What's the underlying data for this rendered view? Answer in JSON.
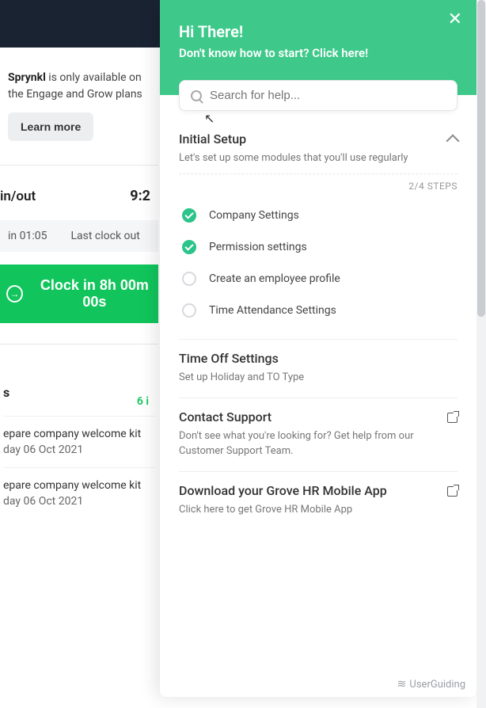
{
  "promo": {
    "brand": "Sprynkl",
    "text_after": " is only available on the Engage and Grow plans",
    "learn_more": "Learn more"
  },
  "clock": {
    "label": "in/out",
    "time": "9:2",
    "last_in_label": "in 01:05",
    "last_out_label": "Last clock out",
    "button": "Clock in 8h 00m 00s"
  },
  "tasks": {
    "label": "s",
    "count": "6 i",
    "items": [
      {
        "title": "epare company welcome kit",
        "date": "day 06 Oct 2021"
      },
      {
        "title": "epare company welcome kit",
        "date": "day 06 Oct 2021"
      }
    ]
  },
  "panel": {
    "greeting": "Hi There!",
    "subtitle": "Don't know how to start? Click here!",
    "search_placeholder": "Search for help...",
    "sections": {
      "setup": {
        "title": "Initial Setup",
        "desc": "Let's set up some modules that you'll use regularly",
        "steps_text": "2/4 STEPS",
        "items": [
          {
            "label": "Company Settings",
            "done": true
          },
          {
            "label": "Permission settings",
            "done": true
          },
          {
            "label": "Create an employee profile",
            "done": false
          },
          {
            "label": "Time Attendance Settings",
            "done": false
          }
        ]
      },
      "timeoff": {
        "title": "Time Off Settings",
        "desc": "Set up Holiday and TO Type"
      },
      "support": {
        "title": "Contact Support",
        "desc": "Don't see what you're looking for? Get help from our Customer Support Team."
      },
      "download": {
        "title": "Download your Grove HR Mobile App",
        "desc": "Click here to get Grove HR Mobile App"
      }
    },
    "footer_brand": "UserGuiding"
  }
}
